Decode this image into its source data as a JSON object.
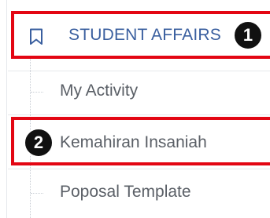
{
  "sidebar": {
    "section": {
      "label": "STUDENT AFFAIRS",
      "icon": "bookmark-icon"
    },
    "items": [
      {
        "label": "My Activity"
      },
      {
        "label": "Kemahiran Insaniah"
      },
      {
        "label": "Poposal Template"
      }
    ]
  },
  "callouts": [
    {
      "number": "1"
    },
    {
      "number": "2"
    }
  ],
  "colors": {
    "highlight": "#e30613",
    "section_text": "#3a5f9f",
    "item_text": "#5a5f66",
    "badge": "#111111"
  }
}
